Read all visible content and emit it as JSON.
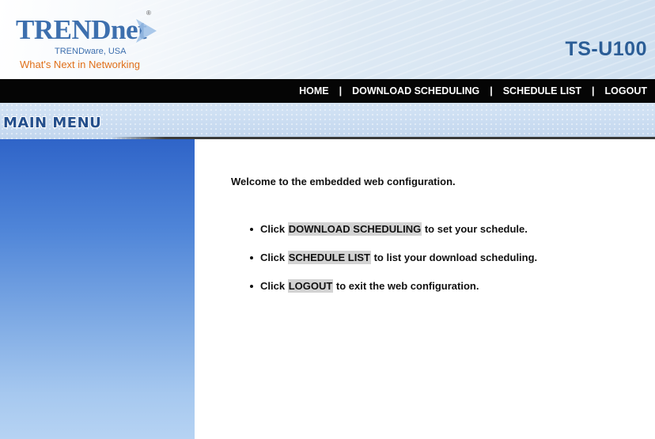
{
  "header": {
    "logo_name": "TRENDnet",
    "logo_sub": "TRENDware, USA",
    "logo_tagline": "What's Next in Networking",
    "logo_registered": "®",
    "model": "TS-U100"
  },
  "nav": {
    "items": [
      "HOME",
      "DOWNLOAD SCHEDULING",
      "SCHEDULE LIST",
      "LOGOUT"
    ],
    "separator": "|"
  },
  "menu_title": "MAIN MENU",
  "content": {
    "welcome": "Welcome to the embedded web configuration.",
    "items": [
      {
        "prefix": "Click ",
        "link": "DOWNLOAD SCHEDULING",
        "suffix": " to set your schedule."
      },
      {
        "prefix": "Click ",
        "link": "SCHEDULE LIST",
        "suffix": " to list your download scheduling."
      },
      {
        "prefix": "Click ",
        "link": "LOGOUT",
        "suffix": " to exit the web configuration."
      }
    ]
  },
  "colors": {
    "brand_blue": "#3d6fae",
    "tagline_orange": "#e0701a",
    "nav_bg": "#050505",
    "sidebar_top": "#2f64c8",
    "sidebar_bottom": "#b6d3f3",
    "link_highlight": "#d3d3d3"
  },
  "icons": {
    "logo_mark": "trendnet-arrow-icon"
  }
}
